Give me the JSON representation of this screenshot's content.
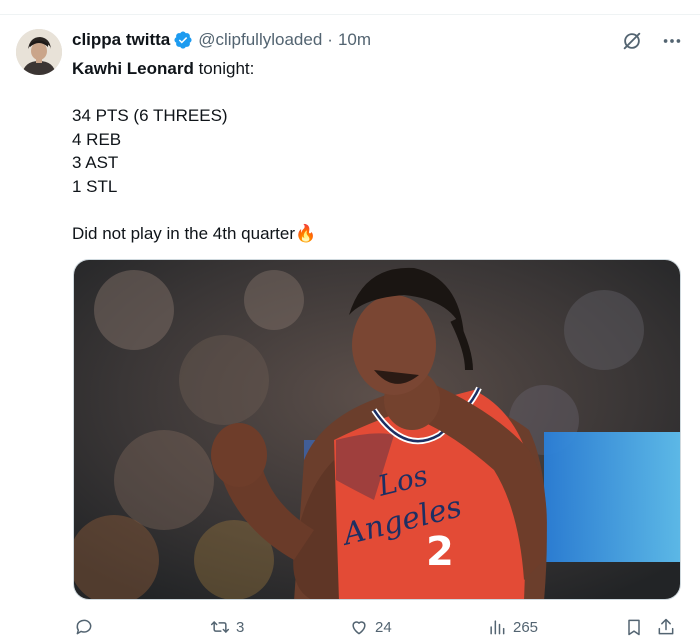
{
  "tweet": {
    "display_name": "clippa twitta",
    "handle": "@clipfullyloaded",
    "separator": "·",
    "time": "10m",
    "mention": "Kawhi Leonard",
    "lines": {
      "intro_rest": " tonight:",
      "pts": "34 PTS (6 THREES)",
      "reb": "4 REB",
      "ast": "3 AST",
      "stl": "1 STL",
      "note": "Did not play in the 4th quarter",
      "note_emoji": "🔥"
    },
    "media": {
      "jersey_city": "Los",
      "jersey_name": "Angeles",
      "jersey_number": "2"
    }
  },
  "actions": {
    "reply_count": "",
    "retweet_count": "3",
    "like_count": "24",
    "view_count": "265"
  },
  "colors": {
    "verified": "#1d9bf0",
    "secondary_text": "#536471",
    "jersey": "#e34b36"
  },
  "icons": [
    "verified-badge-icon",
    "grok-icon",
    "more-icon",
    "reply-icon",
    "retweet-icon",
    "like-icon",
    "views-icon",
    "bookmark-icon",
    "share-icon"
  ]
}
